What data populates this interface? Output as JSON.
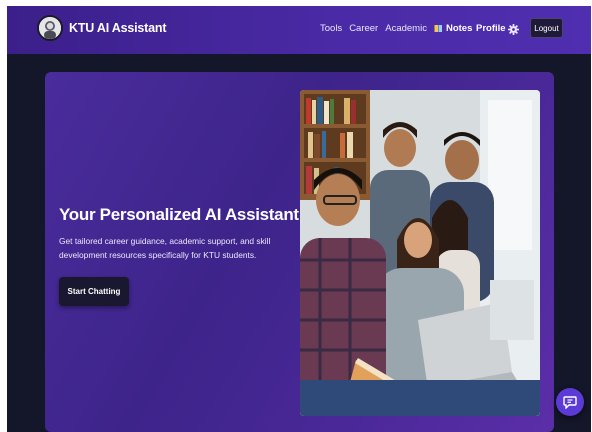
{
  "header": {
    "brand": "KTU AI Assistant",
    "nav": {
      "tools": "Tools",
      "career": "Career",
      "academic": "Academic",
      "notes": "Notes"
    },
    "profile": "Profile",
    "logout": "Logout"
  },
  "hero": {
    "title": "Your Personalized AI Assistant",
    "subtitle": "Get tailored career guidance, academic support, and skill development resources specifically for KTU students.",
    "cta": "Start Chatting"
  },
  "icons": {
    "logo": "avatar-logo-icon",
    "notes": "book-icon",
    "settings": "gear-icon",
    "chat": "chat-bubble-icon"
  },
  "colors": {
    "navbar": "#4a2aa5",
    "hero": "#3d248a",
    "background": "#141629",
    "cta": "#1a1830",
    "chat_fab": "#5b3ad6"
  }
}
